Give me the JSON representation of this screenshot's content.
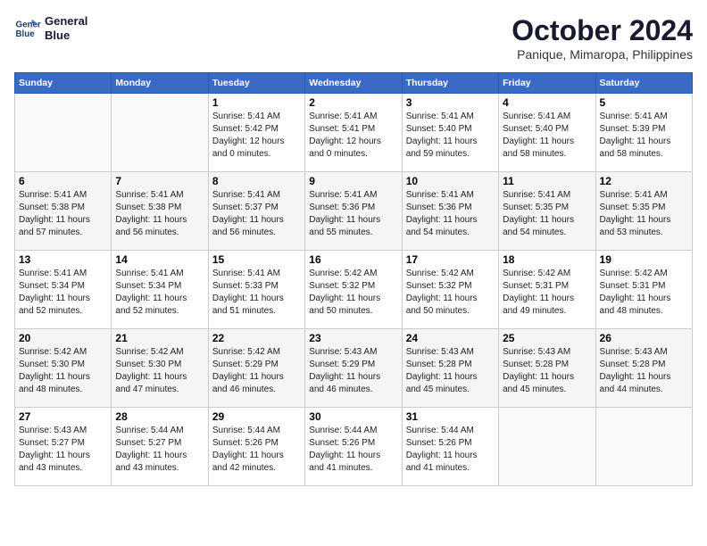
{
  "logo": {
    "line1": "General",
    "line2": "Blue"
  },
  "title": "October 2024",
  "subtitle": "Panique, Mimaropa, Philippines",
  "days_of_week": [
    "Sunday",
    "Monday",
    "Tuesday",
    "Wednesday",
    "Thursday",
    "Friday",
    "Saturday"
  ],
  "weeks": [
    [
      {
        "day": "",
        "info": ""
      },
      {
        "day": "",
        "info": ""
      },
      {
        "day": "1",
        "info": "Sunrise: 5:41 AM\nSunset: 5:42 PM\nDaylight: 12 hours\nand 0 minutes."
      },
      {
        "day": "2",
        "info": "Sunrise: 5:41 AM\nSunset: 5:41 PM\nDaylight: 12 hours\nand 0 minutes."
      },
      {
        "day": "3",
        "info": "Sunrise: 5:41 AM\nSunset: 5:40 PM\nDaylight: 11 hours\nand 59 minutes."
      },
      {
        "day": "4",
        "info": "Sunrise: 5:41 AM\nSunset: 5:40 PM\nDaylight: 11 hours\nand 58 minutes."
      },
      {
        "day": "5",
        "info": "Sunrise: 5:41 AM\nSunset: 5:39 PM\nDaylight: 11 hours\nand 58 minutes."
      }
    ],
    [
      {
        "day": "6",
        "info": "Sunrise: 5:41 AM\nSunset: 5:38 PM\nDaylight: 11 hours\nand 57 minutes."
      },
      {
        "day": "7",
        "info": "Sunrise: 5:41 AM\nSunset: 5:38 PM\nDaylight: 11 hours\nand 56 minutes."
      },
      {
        "day": "8",
        "info": "Sunrise: 5:41 AM\nSunset: 5:37 PM\nDaylight: 11 hours\nand 56 minutes."
      },
      {
        "day": "9",
        "info": "Sunrise: 5:41 AM\nSunset: 5:36 PM\nDaylight: 11 hours\nand 55 minutes."
      },
      {
        "day": "10",
        "info": "Sunrise: 5:41 AM\nSunset: 5:36 PM\nDaylight: 11 hours\nand 54 minutes."
      },
      {
        "day": "11",
        "info": "Sunrise: 5:41 AM\nSunset: 5:35 PM\nDaylight: 11 hours\nand 54 minutes."
      },
      {
        "day": "12",
        "info": "Sunrise: 5:41 AM\nSunset: 5:35 PM\nDaylight: 11 hours\nand 53 minutes."
      }
    ],
    [
      {
        "day": "13",
        "info": "Sunrise: 5:41 AM\nSunset: 5:34 PM\nDaylight: 11 hours\nand 52 minutes."
      },
      {
        "day": "14",
        "info": "Sunrise: 5:41 AM\nSunset: 5:34 PM\nDaylight: 11 hours\nand 52 minutes."
      },
      {
        "day": "15",
        "info": "Sunrise: 5:41 AM\nSunset: 5:33 PM\nDaylight: 11 hours\nand 51 minutes."
      },
      {
        "day": "16",
        "info": "Sunrise: 5:42 AM\nSunset: 5:32 PM\nDaylight: 11 hours\nand 50 minutes."
      },
      {
        "day": "17",
        "info": "Sunrise: 5:42 AM\nSunset: 5:32 PM\nDaylight: 11 hours\nand 50 minutes."
      },
      {
        "day": "18",
        "info": "Sunrise: 5:42 AM\nSunset: 5:31 PM\nDaylight: 11 hours\nand 49 minutes."
      },
      {
        "day": "19",
        "info": "Sunrise: 5:42 AM\nSunset: 5:31 PM\nDaylight: 11 hours\nand 48 minutes."
      }
    ],
    [
      {
        "day": "20",
        "info": "Sunrise: 5:42 AM\nSunset: 5:30 PM\nDaylight: 11 hours\nand 48 minutes."
      },
      {
        "day": "21",
        "info": "Sunrise: 5:42 AM\nSunset: 5:30 PM\nDaylight: 11 hours\nand 47 minutes."
      },
      {
        "day": "22",
        "info": "Sunrise: 5:42 AM\nSunset: 5:29 PM\nDaylight: 11 hours\nand 46 minutes."
      },
      {
        "day": "23",
        "info": "Sunrise: 5:43 AM\nSunset: 5:29 PM\nDaylight: 11 hours\nand 46 minutes."
      },
      {
        "day": "24",
        "info": "Sunrise: 5:43 AM\nSunset: 5:28 PM\nDaylight: 11 hours\nand 45 minutes."
      },
      {
        "day": "25",
        "info": "Sunrise: 5:43 AM\nSunset: 5:28 PM\nDaylight: 11 hours\nand 45 minutes."
      },
      {
        "day": "26",
        "info": "Sunrise: 5:43 AM\nSunset: 5:28 PM\nDaylight: 11 hours\nand 44 minutes."
      }
    ],
    [
      {
        "day": "27",
        "info": "Sunrise: 5:43 AM\nSunset: 5:27 PM\nDaylight: 11 hours\nand 43 minutes."
      },
      {
        "day": "28",
        "info": "Sunrise: 5:44 AM\nSunset: 5:27 PM\nDaylight: 11 hours\nand 43 minutes."
      },
      {
        "day": "29",
        "info": "Sunrise: 5:44 AM\nSunset: 5:26 PM\nDaylight: 11 hours\nand 42 minutes."
      },
      {
        "day": "30",
        "info": "Sunrise: 5:44 AM\nSunset: 5:26 PM\nDaylight: 11 hours\nand 41 minutes."
      },
      {
        "day": "31",
        "info": "Sunrise: 5:44 AM\nSunset: 5:26 PM\nDaylight: 11 hours\nand 41 minutes."
      },
      {
        "day": "",
        "info": ""
      },
      {
        "day": "",
        "info": ""
      }
    ]
  ]
}
